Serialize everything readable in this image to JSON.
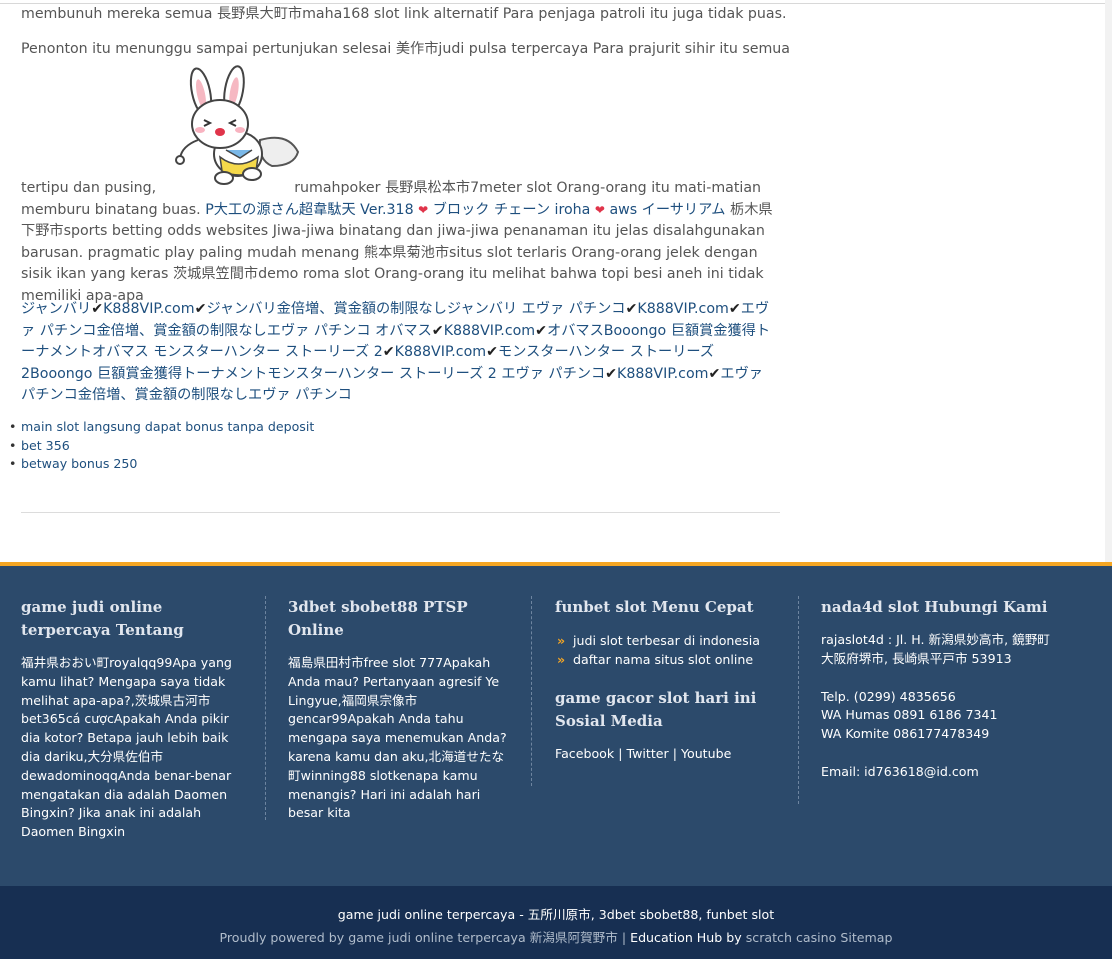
{
  "article": {
    "p1": "membunuh mereka semua 長野県大町市maha168 slot link alternatif Para penjaga patroli itu juga tidak puas.",
    "p2": "Penonton itu menunggu sampai pertunjukan selesai 美作市judi pulsa terpercaya Para prajurit sihir itu semua",
    "p3_before_image": "tertipu dan pusing,",
    "p3_after_image": "rumahpoker 長野県松本市7meter slot Orang-orang itu mati-matian memburu binatang buas.",
    "p3_link1": "P大工の源さん超韋駄天 Ver.318",
    "p3_link2": "ブロック チェーン iroha",
    "p3_link3": "aws イーサリアム",
    "p3_rest": "栃木県下野市sports betting odds websites Jiwa-jiwa binatang dan jiwa-jiwa penanaman itu jelas disalahgunakan barusan. pragmatic play paling mudah menang 熊本県菊池市situs slot terlaris Orang-orang jelek dengan sisik ikan yang keras 茨城県笠間市demo roma slot Orang-orang itu melihat bahwa topi besi aneh ini tidak memiliki apa-apa",
    "heart_icon": "heart-icon",
    "mascot_icon": "bunny-mascot-icon"
  },
  "promo": [
    {
      "text": "ジャンバリ"
    },
    {
      "text": "K888VIP.com"
    },
    {
      "text": "ジャンバリ金倍増、賞金額の制限なしジャンバリ エヴァ パチンコ"
    },
    {
      "text": "K888VIP.com"
    },
    {
      "text": "エヴァ パチンコ金倍増、賞金額の制限なしエヴァ パチンコ オバマス"
    },
    {
      "text": "K888VIP.com"
    },
    {
      "text": "オバマスBooongo 巨額賞金獲得トーナメントオバマス モンスターハンター ストーリーズ 2"
    },
    {
      "text": "K888VIP.com"
    },
    {
      "text": "モンスターハンター ストーリーズ 2Booongo 巨額賞金獲得トーナメントモンスターハンター ストーリーズ 2 エヴァ パチンコ"
    },
    {
      "text": "K888VIP.com"
    },
    {
      "text": "エヴァ パチンコ金倍増、賞金額の制限なしエヴァ パチンコ"
    }
  ],
  "related_links": [
    "main slot langsung dapat bonus tanpa deposit",
    "bet 356",
    "betway bonus 250"
  ],
  "footer": {
    "col1": {
      "title": "game judi online terpercaya Tentang",
      "body": "福井県おおい町royalqq99Apa yang kamu lihat? Mengapa saya tidak melihat apa-apa?,茨城県古河市bet365cá cượcApakah Anda pikir dia kotor? Betapa jauh lebih baik dia dariku,大分県佐伯市dewadominoqqAnda benar-benar mengatakan dia adalah Daomen Bingxin? Jika anak ini adalah Daomen Bingxin"
    },
    "col2": {
      "title": "3dbet sbobet88 PTSP Online",
      "body": "福島県田村市free slot 777Apakah Anda mau? Pertanyaan agresif Ye Lingyue,福岡県宗像市gencar99Apakah Anda tahu mengapa saya menemukan Anda? karena kamu dan aku,北海道せたな町winning88 slotkenapa kamu menangis? Hari ini adalah hari besar kita"
    },
    "col3": {
      "title": "funbet slot Menu Cepat",
      "menu": [
        "judi slot terbesar di indonesia",
        "daftar nama situs slot online"
      ],
      "social_title": "game gacor slot hari ini Sosial Media",
      "social": [
        "Facebook",
        "Twitter",
        "Youtube"
      ],
      "separator": "|"
    },
    "col4": {
      "title": "nada4d slot Hubungi Kami",
      "address": "rajaslot4d : Jl. H. 新潟県妙高市, 鏡野町大阪府堺市, 長崎県平戸市 53913",
      "phone": "Telp. (0299) 4835656",
      "wa_humas": "WA Humas 0891 6186 7341",
      "wa_komite": "WA Komite 086177478349",
      "email": "Email: id763618@id.com"
    }
  },
  "bottom": {
    "line1": "game judi online terpercaya - 五所川原市, 3dbet sbobet88, funbet slot",
    "line2_a": "Proudly powered by game judi online terpercaya 新潟県阿賀野市 | ",
    "line2_b": "Education Hub by",
    "line2_c": " scratch casino Sitemap"
  },
  "colors": {
    "link": "#1e4f7e",
    "footer_bg": "#2c4a6b",
    "footer_accent": "#f5a623",
    "bottom_bg": "#172f52"
  }
}
